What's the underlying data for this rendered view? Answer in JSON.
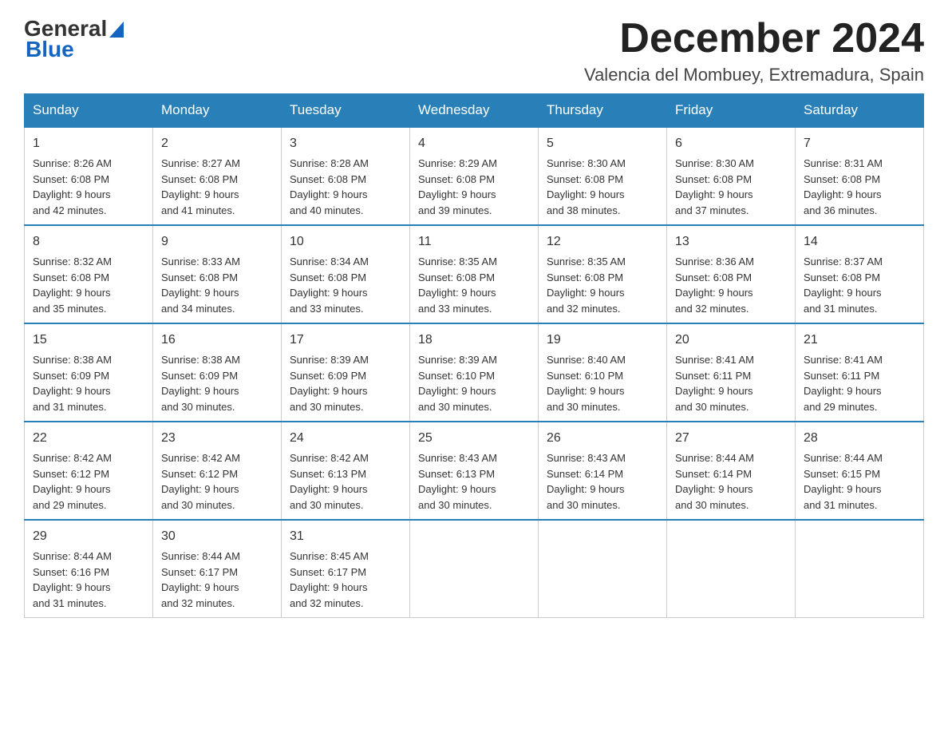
{
  "logo": {
    "general": "General",
    "blue": "Blue"
  },
  "title": {
    "month": "December 2024",
    "location": "Valencia del Mombuey, Extremadura, Spain"
  },
  "weekdays": [
    "Sunday",
    "Monday",
    "Tuesday",
    "Wednesday",
    "Thursday",
    "Friday",
    "Saturday"
  ],
  "weeks": [
    [
      {
        "day": "1",
        "sunrise": "8:26 AM",
        "sunset": "6:08 PM",
        "daylight": "9 hours and 42 minutes."
      },
      {
        "day": "2",
        "sunrise": "8:27 AM",
        "sunset": "6:08 PM",
        "daylight": "9 hours and 41 minutes."
      },
      {
        "day": "3",
        "sunrise": "8:28 AM",
        "sunset": "6:08 PM",
        "daylight": "9 hours and 40 minutes."
      },
      {
        "day": "4",
        "sunrise": "8:29 AM",
        "sunset": "6:08 PM",
        "daylight": "9 hours and 39 minutes."
      },
      {
        "day": "5",
        "sunrise": "8:30 AM",
        "sunset": "6:08 PM",
        "daylight": "9 hours and 38 minutes."
      },
      {
        "day": "6",
        "sunrise": "8:30 AM",
        "sunset": "6:08 PM",
        "daylight": "9 hours and 37 minutes."
      },
      {
        "day": "7",
        "sunrise": "8:31 AM",
        "sunset": "6:08 PM",
        "daylight": "9 hours and 36 minutes."
      }
    ],
    [
      {
        "day": "8",
        "sunrise": "8:32 AM",
        "sunset": "6:08 PM",
        "daylight": "9 hours and 35 minutes."
      },
      {
        "day": "9",
        "sunrise": "8:33 AM",
        "sunset": "6:08 PM",
        "daylight": "9 hours and 34 minutes."
      },
      {
        "day": "10",
        "sunrise": "8:34 AM",
        "sunset": "6:08 PM",
        "daylight": "9 hours and 33 minutes."
      },
      {
        "day": "11",
        "sunrise": "8:35 AM",
        "sunset": "6:08 PM",
        "daylight": "9 hours and 33 minutes."
      },
      {
        "day": "12",
        "sunrise": "8:35 AM",
        "sunset": "6:08 PM",
        "daylight": "9 hours and 32 minutes."
      },
      {
        "day": "13",
        "sunrise": "8:36 AM",
        "sunset": "6:08 PM",
        "daylight": "9 hours and 32 minutes."
      },
      {
        "day": "14",
        "sunrise": "8:37 AM",
        "sunset": "6:08 PM",
        "daylight": "9 hours and 31 minutes."
      }
    ],
    [
      {
        "day": "15",
        "sunrise": "8:38 AM",
        "sunset": "6:09 PM",
        "daylight": "9 hours and 31 minutes."
      },
      {
        "day": "16",
        "sunrise": "8:38 AM",
        "sunset": "6:09 PM",
        "daylight": "9 hours and 30 minutes."
      },
      {
        "day": "17",
        "sunrise": "8:39 AM",
        "sunset": "6:09 PM",
        "daylight": "9 hours and 30 minutes."
      },
      {
        "day": "18",
        "sunrise": "8:39 AM",
        "sunset": "6:10 PM",
        "daylight": "9 hours and 30 minutes."
      },
      {
        "day": "19",
        "sunrise": "8:40 AM",
        "sunset": "6:10 PM",
        "daylight": "9 hours and 30 minutes."
      },
      {
        "day": "20",
        "sunrise": "8:41 AM",
        "sunset": "6:11 PM",
        "daylight": "9 hours and 30 minutes."
      },
      {
        "day": "21",
        "sunrise": "8:41 AM",
        "sunset": "6:11 PM",
        "daylight": "9 hours and 29 minutes."
      }
    ],
    [
      {
        "day": "22",
        "sunrise": "8:42 AM",
        "sunset": "6:12 PM",
        "daylight": "9 hours and 29 minutes."
      },
      {
        "day": "23",
        "sunrise": "8:42 AM",
        "sunset": "6:12 PM",
        "daylight": "9 hours and 30 minutes."
      },
      {
        "day": "24",
        "sunrise": "8:42 AM",
        "sunset": "6:13 PM",
        "daylight": "9 hours and 30 minutes."
      },
      {
        "day": "25",
        "sunrise": "8:43 AM",
        "sunset": "6:13 PM",
        "daylight": "9 hours and 30 minutes."
      },
      {
        "day": "26",
        "sunrise": "8:43 AM",
        "sunset": "6:14 PM",
        "daylight": "9 hours and 30 minutes."
      },
      {
        "day": "27",
        "sunrise": "8:44 AM",
        "sunset": "6:14 PM",
        "daylight": "9 hours and 30 minutes."
      },
      {
        "day": "28",
        "sunrise": "8:44 AM",
        "sunset": "6:15 PM",
        "daylight": "9 hours and 31 minutes."
      }
    ],
    [
      {
        "day": "29",
        "sunrise": "8:44 AM",
        "sunset": "6:16 PM",
        "daylight": "9 hours and 31 minutes."
      },
      {
        "day": "30",
        "sunrise": "8:44 AM",
        "sunset": "6:17 PM",
        "daylight": "9 hours and 32 minutes."
      },
      {
        "day": "31",
        "sunrise": "8:45 AM",
        "sunset": "6:17 PM",
        "daylight": "9 hours and 32 minutes."
      },
      null,
      null,
      null,
      null
    ]
  ],
  "labels": {
    "sunrise": "Sunrise:",
    "sunset": "Sunset:",
    "daylight": "Daylight:"
  }
}
